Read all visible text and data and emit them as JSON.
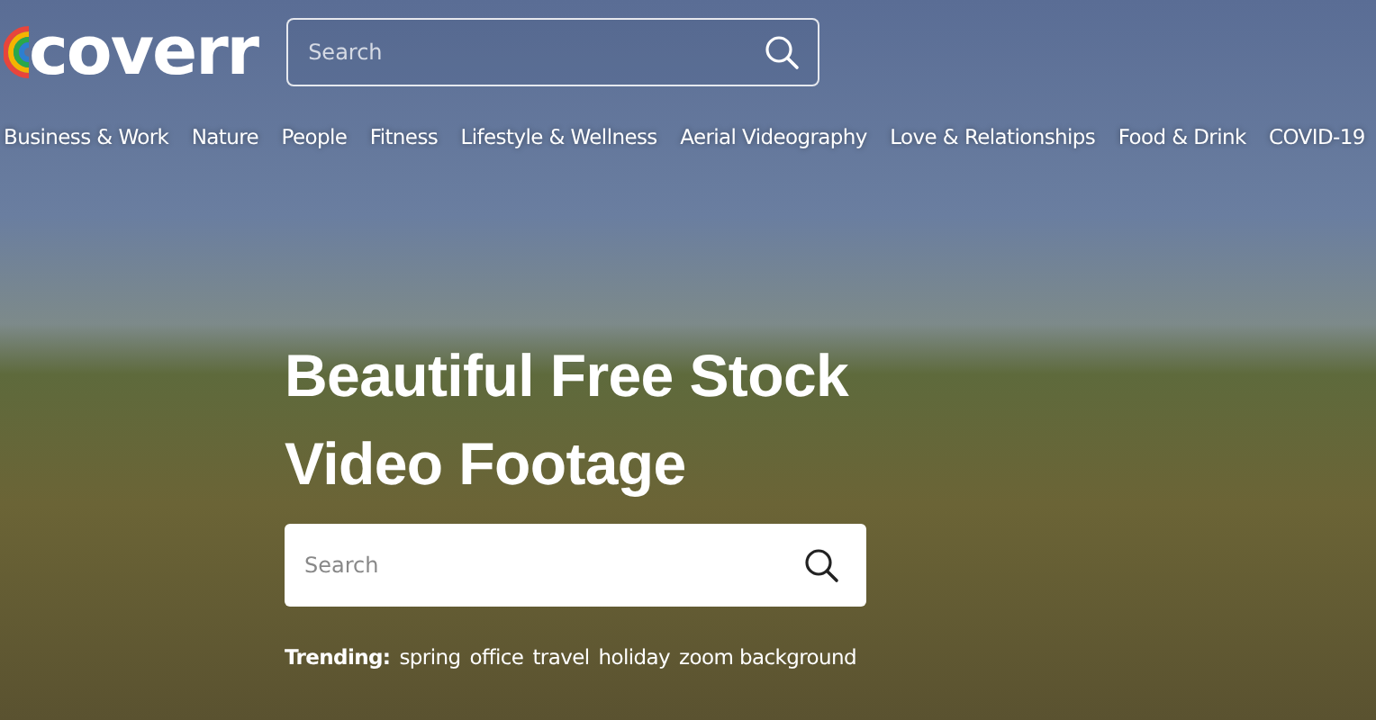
{
  "header": {
    "logo": "coverr",
    "search": {
      "placeholder": "Search"
    }
  },
  "categories": [
    "Business & Work",
    "Nature",
    "People",
    "Fitness",
    "Lifestyle & Wellness",
    "Aerial Videography",
    "Love & Relationships",
    "Food & Drink",
    "COVID-19"
  ],
  "hero": {
    "title": "Beautiful Free Stock Video Footage",
    "search": {
      "placeholder": "Search"
    },
    "trending_label": "Trending:",
    "trending": [
      "spring",
      "office",
      "travel",
      "holiday",
      "zoom background"
    ]
  }
}
